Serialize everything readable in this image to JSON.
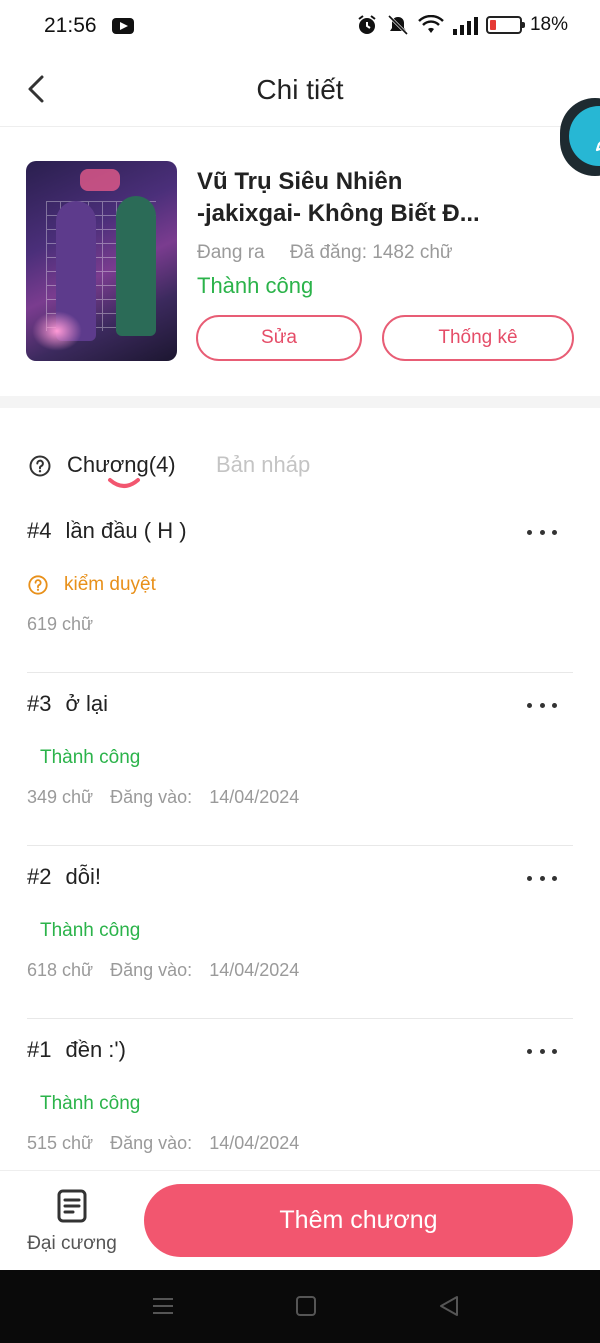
{
  "status_bar": {
    "time": "21:56",
    "battery": "18%"
  },
  "header": {
    "title": "Chi tiết"
  },
  "book": {
    "title_line1": "Vũ Trụ Siêu Nhiên",
    "title_line2": "-jakixgai- Không Biết Đ...",
    "state": "Đang ra",
    "published_count": "Đã đăng: 1482 chữ",
    "status": "Thành công",
    "edit_label": "Sửa",
    "stats_label": "Thống kê"
  },
  "tabs": {
    "chapters": "Chương(4)",
    "drafts": "Bản nháp"
  },
  "chapters": [
    {
      "number": "#4",
      "title": "lần đầu ( H )",
      "status": "kiểm duyệt",
      "words": "619 chữ",
      "posted_label": "",
      "posted_date": ""
    },
    {
      "number": "#3",
      "title": "ở lại",
      "status": "Thành công",
      "words": "349 chữ",
      "posted_label": "Đăng vào:",
      "posted_date": "14/04/2024"
    },
    {
      "number": "#2",
      "title": "dỗi!",
      "status": "Thành công",
      "words": "618 chữ",
      "posted_label": "Đăng vào:",
      "posted_date": "14/04/2024"
    },
    {
      "number": "#1",
      "title": "đền :')",
      "status": "Thành công",
      "words": "515 chữ",
      "posted_label": "Đăng vào:",
      "posted_date": "14/04/2024"
    }
  ],
  "bottom": {
    "outline_label": "Đại cương",
    "add_chapter_label": "Thêm chương"
  },
  "colors": {
    "accent": "#f2566f",
    "success": "#2bb34a",
    "review": "#e8901a",
    "fab": "#27b7d4"
  }
}
